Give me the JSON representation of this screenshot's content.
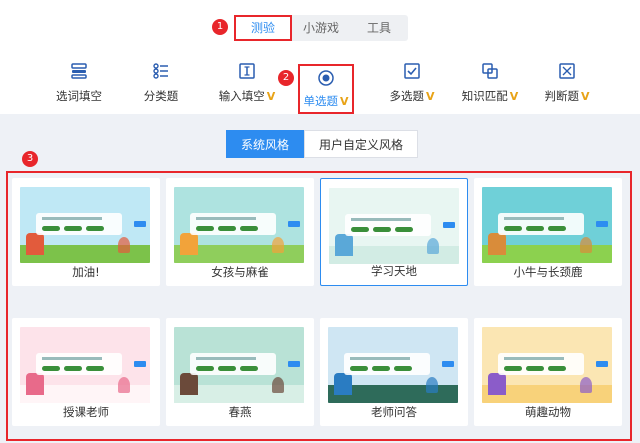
{
  "top_tabs": [
    {
      "label": "测验",
      "active": true
    },
    {
      "label": "小游戏",
      "active": false
    },
    {
      "label": "工具",
      "active": false
    }
  ],
  "callouts": [
    "1",
    "2",
    "3"
  ],
  "question_types": [
    {
      "label": "选词填空",
      "icon": "grid-fill-icon",
      "vip": ""
    },
    {
      "label": "分类题",
      "icon": "list-sort-icon",
      "vip": ""
    },
    {
      "label": "输入填空",
      "icon": "text-input-icon",
      "vip": "V"
    },
    {
      "label": "单选题",
      "icon": "radio-icon",
      "vip": "V"
    },
    {
      "label": "多选题",
      "icon": "checkbox-icon",
      "vip": "V"
    },
    {
      "label": "知识匹配",
      "icon": "match-icon",
      "vip": "V"
    },
    {
      "label": "判断题",
      "icon": "true-false-icon",
      "vip": "V"
    }
  ],
  "style_tabs": [
    {
      "label": "系统风格",
      "active": true
    },
    {
      "label": "用户自定义风格",
      "active": false
    }
  ],
  "templates": [
    {
      "name": "加油!",
      "bg": "#bfe8f5",
      "ground": "#7cc24a",
      "accent": "#e25b3c",
      "selected": false
    },
    {
      "name": "女孩与麻雀",
      "bg": "#aee3e0",
      "ground": "#8fce5c",
      "accent": "#f2a33a",
      "selected": false
    },
    {
      "name": "学习天地",
      "bg": "#e8f6f2",
      "ground": "#d2ece4",
      "accent": "#5aa8d8",
      "selected": true
    },
    {
      "name": "小牛与长颈鹿",
      "bg": "#6fd0d8",
      "ground": "#8cd14f",
      "accent": "#d98c3a",
      "selected": false
    },
    {
      "name": "授课老师",
      "bg": "#fde3ea",
      "ground": "#fff5f7",
      "accent": "#e86a8a",
      "selected": false
    },
    {
      "name": "春燕",
      "bg": "#b9e2d6",
      "ground": "#d8efe6",
      "accent": "#6b4a3a",
      "selected": false
    },
    {
      "name": "老师问答",
      "bg": "#cfe6f3",
      "ground": "#2e6b5a",
      "accent": "#2a7cc2",
      "selected": false
    },
    {
      "name": "萌趣动物",
      "bg": "#fbe6b3",
      "ground": "#f8d27a",
      "accent": "#8b5cc9",
      "selected": false
    }
  ]
}
